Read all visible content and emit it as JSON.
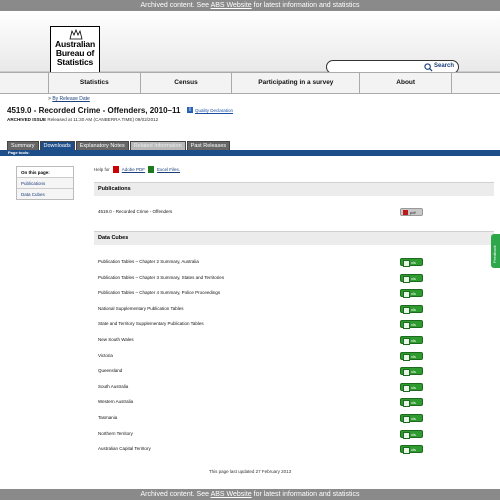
{
  "banner": {
    "text_before": "Archived content. See ",
    "link": "ABS Website",
    "text_after": " for latest information and statistics"
  },
  "logo": {
    "line1": "Australian",
    "line2": "Bureau of",
    "line3": "Statistics"
  },
  "search": {
    "value": "",
    "placeholder": "",
    "button_label": "Search"
  },
  "nav": [
    "Statistics",
    "Census",
    "Participating in a survey",
    "About"
  ],
  "breadcrumb": {
    "prefix": "> ",
    "link": "By Release Date"
  },
  "page": {
    "title": "4519.0 - Recorded Crime - Offenders, 2010–11",
    "quality_link": "Quality Declaration",
    "archived_label": "ARCHIVED ISSUE",
    "archived_text": " Released at 11:30 AM (CANBERRA TIME) 09/02/2012"
  },
  "tabs": [
    "Summary",
    "Downloads",
    "Explanatory Notes",
    "Related Information",
    "Past Releases"
  ],
  "tab_bar_label": "Page tools:",
  "toc": {
    "heading": "On this page:",
    "items": [
      "Publications",
      "Data Cubes"
    ]
  },
  "help": {
    "label": "Help for",
    "pdf": "Adobe PDF",
    "excel": "Excel Files."
  },
  "publications": {
    "heading": "Publications",
    "rows": [
      {
        "label": "4519.0 - Recorded Crime - Offenders",
        "format": "pdf"
      }
    ]
  },
  "data_cubes": {
    "heading": "Data Cubes",
    "rows": [
      "Publication Tables – Chapter 2 Summary, Australia",
      "Publication Tables – Chapter 3 Summary, States and Territories",
      "Publication Tables – Chapter 4 Summary, Police Proceedings",
      "National Supplementary Publication Tables",
      "State and Territory Supplementary Publication Tables",
      "New South Wales",
      "Victoria",
      "Queensland",
      "South Australia",
      "Western Australia",
      "Tasmania",
      "Northern Territory",
      "Australian Capital Territory"
    ]
  },
  "button_labels": {
    "pdf": "pdf",
    "xls": "xls"
  },
  "updated": "This page last updated 27 February 2013",
  "feedback": "Feedback",
  "colors": {
    "nav_blue": "#1d4e8a",
    "banner_grey": "#8a8a8a",
    "xls_green": "#2f9a2f",
    "pdf_red": "#c01818"
  }
}
